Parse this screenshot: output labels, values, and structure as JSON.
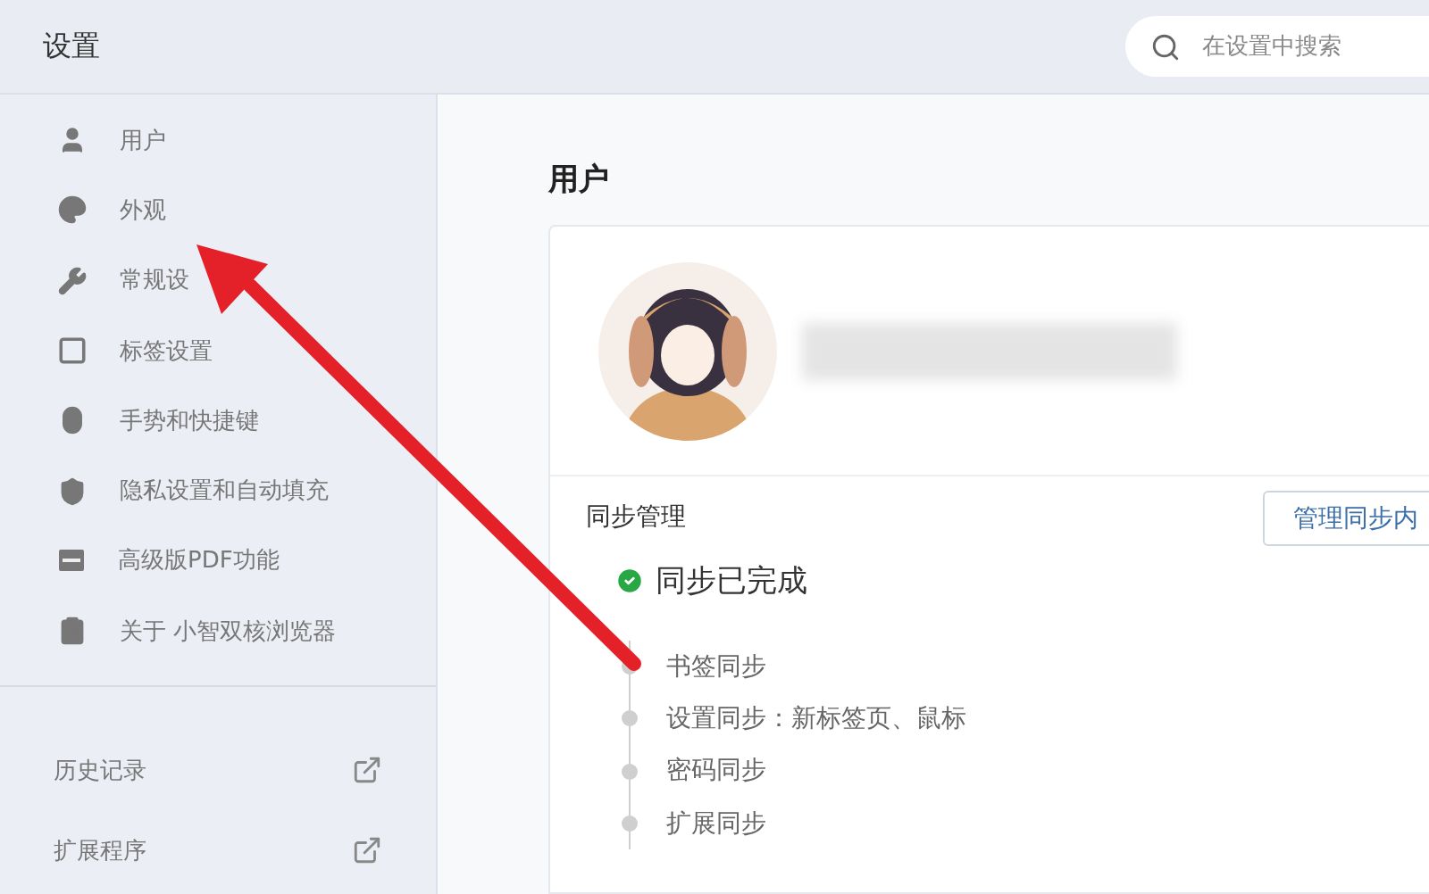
{
  "header": {
    "title": "设置",
    "search": {
      "placeholder": "在设置中搜索"
    }
  },
  "sidebar": {
    "items": [
      {
        "label": "用户",
        "selected": false
      },
      {
        "label": "外观",
        "selected": false
      },
      {
        "label": "常规设",
        "selected": false
      },
      {
        "label": "标签设置",
        "selected": false
      },
      {
        "label": "手势和快捷键",
        "selected": false
      },
      {
        "label": "隐私设置和自动填充",
        "selected": false
      },
      {
        "label": "高级版PDF功能",
        "selected": false
      },
      {
        "label": "关于 小智双核浏览器",
        "selected": false
      }
    ],
    "links": [
      {
        "label": "历史记录"
      },
      {
        "label": "扩展程序"
      }
    ]
  },
  "main": {
    "title": "用户",
    "sync": {
      "title": "同步管理",
      "button": "管理同步内",
      "status": "同步已完成",
      "items": [
        "书签同步",
        "设置同步：新标签页、鼠标",
        "密码同步",
        "扩展同步"
      ]
    }
  }
}
